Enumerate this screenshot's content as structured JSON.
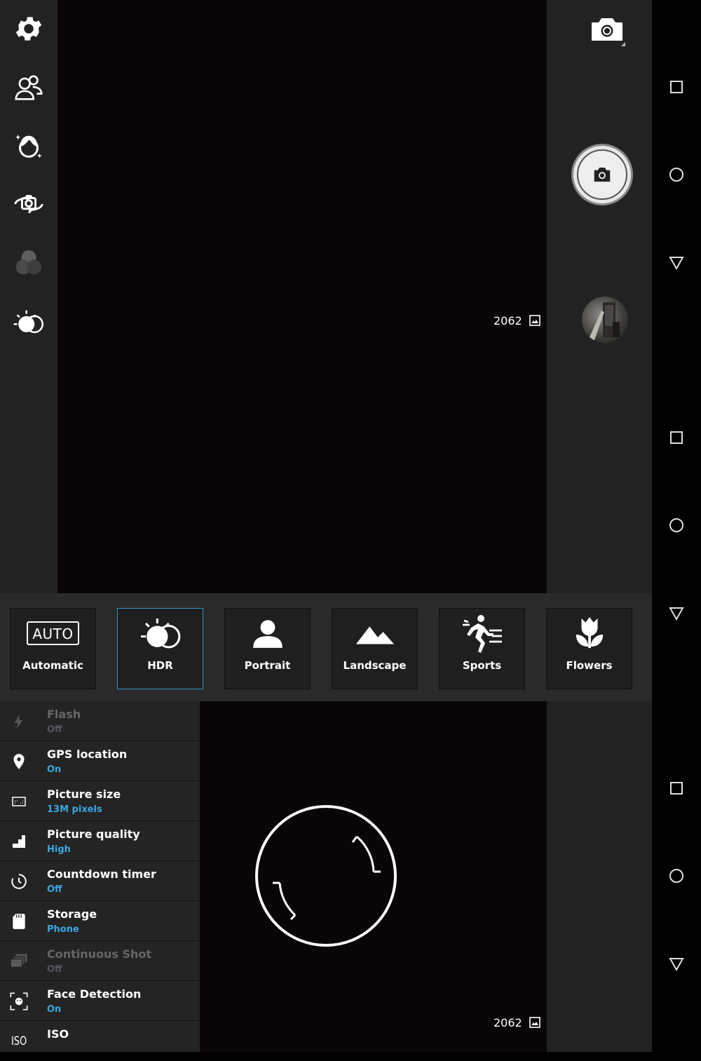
{
  "camera": {
    "photo_count_top": "2062",
    "photo_count_bottom": "2062"
  },
  "left_rail": {
    "items": [
      {
        "name": "settings-icon"
      },
      {
        "name": "multi-user-icon"
      },
      {
        "name": "beauty-face-icon"
      },
      {
        "name": "switch-camera-icon"
      },
      {
        "name": "color-effect-icon"
      },
      {
        "name": "hdr-icon"
      }
    ]
  },
  "scene_modes": [
    {
      "label": "Automatic",
      "icon": "auto-text-icon",
      "icon_text": "AUTO",
      "selected": false
    },
    {
      "label": "HDR",
      "icon": "hdr-icon",
      "selected": true
    },
    {
      "label": "Portrait",
      "icon": "person-icon",
      "selected": false
    },
    {
      "label": "Landscape",
      "icon": "mountain-icon",
      "selected": false
    },
    {
      "label": "Sports",
      "icon": "runner-icon",
      "selected": false
    },
    {
      "label": "Flowers",
      "icon": "tulip-icon",
      "selected": false
    }
  ],
  "settings": [
    {
      "title": "Flash",
      "value": "Off",
      "icon": "flash-icon",
      "disabled": true
    },
    {
      "title": "GPS location",
      "value": "On",
      "icon": "location-pin-icon",
      "disabled": false
    },
    {
      "title": "Picture size",
      "value": "13M pixels",
      "icon": "picture-size-icon",
      "disabled": false
    },
    {
      "title": "Picture quality",
      "value": "High",
      "icon": "quality-steps-icon",
      "disabled": false
    },
    {
      "title": "Countdown timer",
      "value": "Off",
      "icon": "timer-icon",
      "disabled": false
    },
    {
      "title": "Storage",
      "value": "Phone",
      "icon": "sd-card-icon",
      "disabled": false
    },
    {
      "title": "Continuous Shot",
      "value": "Off",
      "icon": "burst-icon",
      "disabled": true
    },
    {
      "title": "Face Detection",
      "value": "On",
      "icon": "face-detect-icon",
      "disabled": false
    },
    {
      "title": "ISO",
      "value": "",
      "icon": "iso-icon",
      "icon_text": "ISO",
      "disabled": false
    }
  ],
  "colors": {
    "accent": "#3aa7e0",
    "panel": "#222222",
    "viewfinder": "#0a0506"
  }
}
